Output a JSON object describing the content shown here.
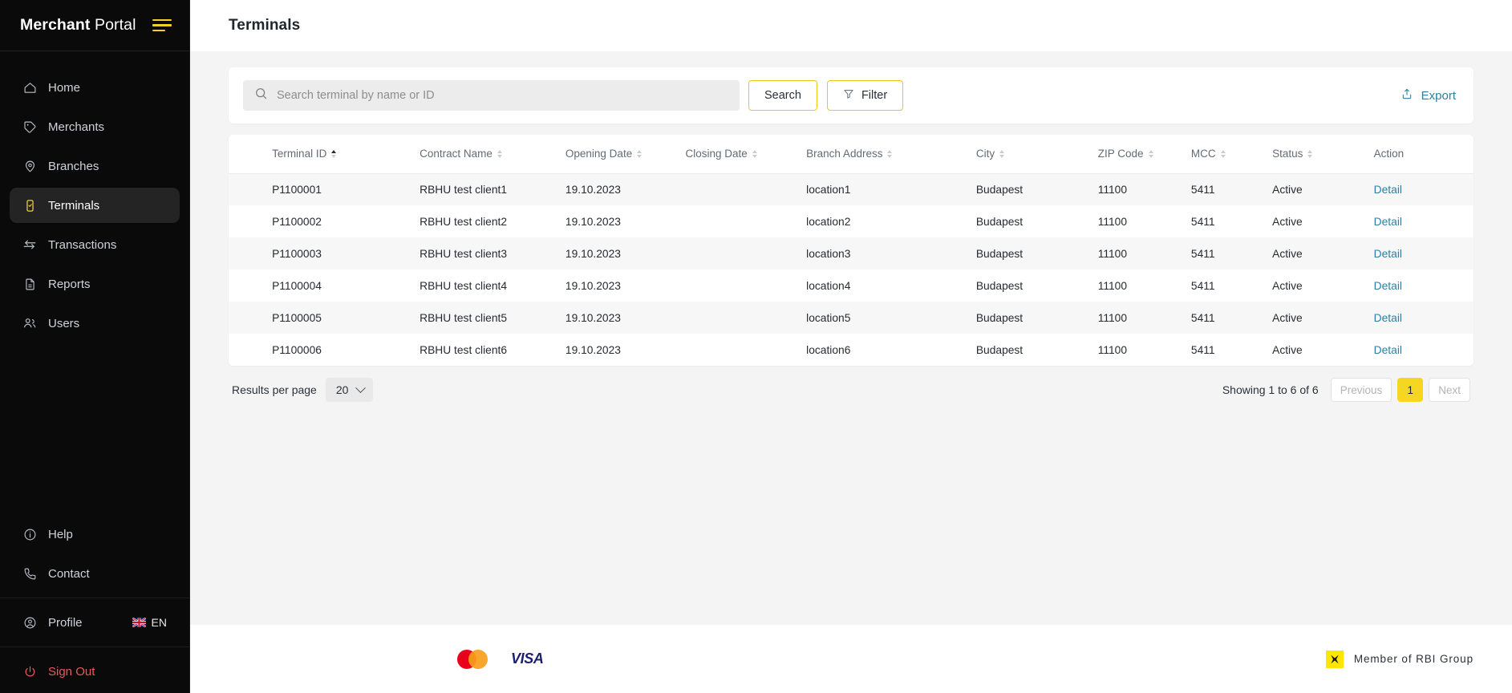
{
  "sidebar": {
    "brand_bold": "Merchant",
    "brand_light": " Portal",
    "menu_icon": "hamburger-icon",
    "items": [
      {
        "label": "Home",
        "icon": "home-icon",
        "active": false
      },
      {
        "label": "Merchants",
        "icon": "tag-icon",
        "active": false
      },
      {
        "label": "Branches",
        "icon": "map-pin-icon",
        "active": false
      },
      {
        "label": "Terminals",
        "icon": "terminal-icon",
        "active": true
      },
      {
        "label": "Transactions",
        "icon": "exchange-icon",
        "active": false
      },
      {
        "label": "Reports",
        "icon": "document-icon",
        "active": false
      },
      {
        "label": "Users",
        "icon": "users-icon",
        "active": false
      }
    ],
    "bottom_items": [
      {
        "label": "Help",
        "icon": "info-icon"
      },
      {
        "label": "Contact",
        "icon": "phone-icon"
      }
    ],
    "profile": {
      "label": "Profile",
      "icon": "user-circle-icon",
      "language": "EN",
      "flag": "uk-flag-icon"
    },
    "sign_out": {
      "label": "Sign Out",
      "icon": "power-icon"
    }
  },
  "header": {
    "title": "Terminals"
  },
  "toolbar": {
    "search_placeholder": "Search terminal by name or ID",
    "search_value": "",
    "search_icon": "search-icon",
    "search_button": "Search",
    "filter_button": "Filter",
    "filter_icon": "funnel-icon",
    "export_label": "Export",
    "export_icon": "export-icon"
  },
  "table": {
    "columns": [
      {
        "label": "Terminal ID",
        "sortable": true,
        "sorted": "asc"
      },
      {
        "label": "Contract Name",
        "sortable": true,
        "sorted": "none"
      },
      {
        "label": "Opening Date",
        "sortable": true,
        "sorted": "none"
      },
      {
        "label": "Closing Date",
        "sortable": true,
        "sorted": "none"
      },
      {
        "label": "Branch Address",
        "sortable": true,
        "sorted": "none"
      },
      {
        "label": "City",
        "sortable": true,
        "sorted": "none"
      },
      {
        "label": "ZIP Code",
        "sortable": true,
        "sorted": "none"
      },
      {
        "label": "MCC",
        "sortable": true,
        "sorted": "none"
      },
      {
        "label": "Status",
        "sortable": true,
        "sorted": "none"
      },
      {
        "label": "Action",
        "sortable": false,
        "sorted": "none"
      }
    ],
    "rows": [
      {
        "terminal_id": "P1100001",
        "contract_name": "RBHU test client1",
        "opening_date": "19.10.2023",
        "closing_date": "",
        "branch_address": "location1",
        "city": "Budapest",
        "zip": "11100",
        "mcc": "5411",
        "status": "Active",
        "action": "Detail"
      },
      {
        "terminal_id": "P1100002",
        "contract_name": "RBHU test client2",
        "opening_date": "19.10.2023",
        "closing_date": "",
        "branch_address": "location2",
        "city": "Budapest",
        "zip": "11100",
        "mcc": "5411",
        "status": "Active",
        "action": "Detail"
      },
      {
        "terminal_id": "P1100003",
        "contract_name": "RBHU test client3",
        "opening_date": "19.10.2023",
        "closing_date": "",
        "branch_address": "location3",
        "city": "Budapest",
        "zip": "11100",
        "mcc": "5411",
        "status": "Active",
        "action": "Detail"
      },
      {
        "terminal_id": "P1100004",
        "contract_name": "RBHU test client4",
        "opening_date": "19.10.2023",
        "closing_date": "",
        "branch_address": "location4",
        "city": "Budapest",
        "zip": "11100",
        "mcc": "5411",
        "status": "Active",
        "action": "Detail"
      },
      {
        "terminal_id": "P1100005",
        "contract_name": "RBHU test client5",
        "opening_date": "19.10.2023",
        "closing_date": "",
        "branch_address": "location5",
        "city": "Budapest",
        "zip": "11100",
        "mcc": "5411",
        "status": "Active",
        "action": "Detail"
      },
      {
        "terminal_id": "P1100006",
        "contract_name": "RBHU test client6",
        "opening_date": "19.10.2023",
        "closing_date": "",
        "branch_address": "location6",
        "city": "Budapest",
        "zip": "11100",
        "mcc": "5411",
        "status": "Active",
        "action": "Detail"
      }
    ]
  },
  "pagination": {
    "results_per_page_label": "Results per page",
    "results_per_page_value": "20",
    "showing_text": "Showing 1 to 6 of 6",
    "previous_label": "Previous",
    "next_label": "Next",
    "current_page": "1"
  },
  "page_footer": {
    "mastercard_icon": "mastercard-logo",
    "visa_label": "VISA",
    "rbi_icon": "rbi-logo",
    "rbi_text": "Member of RBI Group"
  },
  "colors": {
    "accent_yellow": "#f5d621",
    "sidebar_bg": "#0a0a0a",
    "link_teal": "#2e7fa0",
    "signout_red": "#e8595c",
    "row_stripe": "#f7f7f7"
  }
}
